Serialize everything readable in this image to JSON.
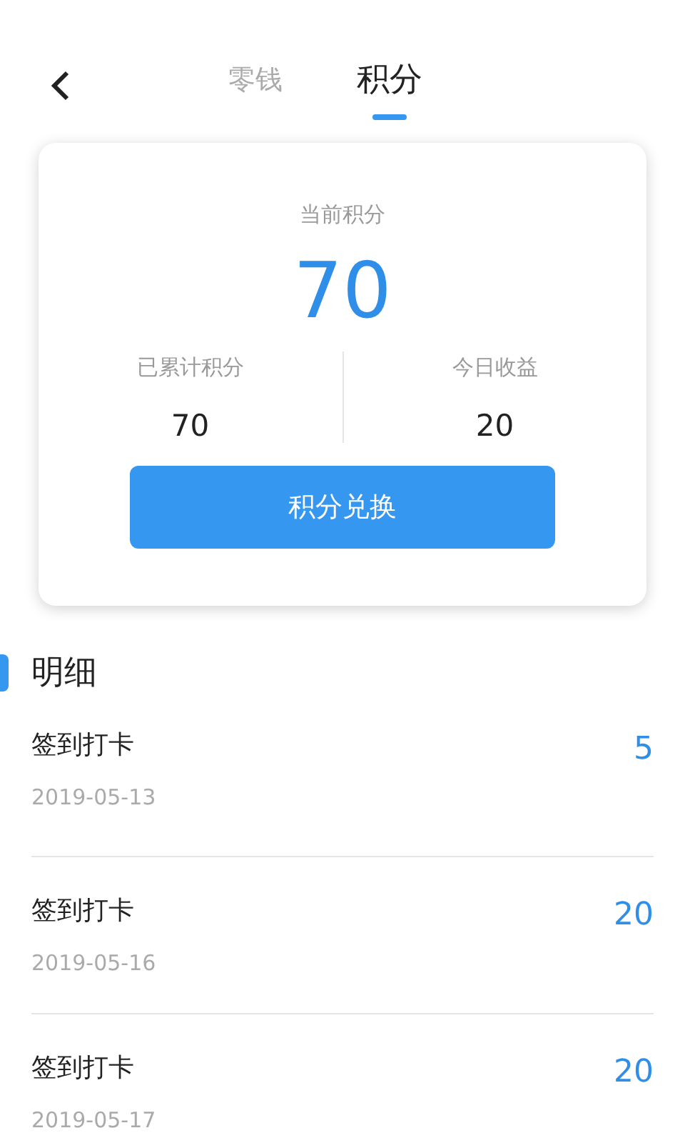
{
  "header": {
    "tabs": [
      {
        "label": "零钱",
        "selected": false
      },
      {
        "label": "积分",
        "selected": true
      }
    ]
  },
  "card": {
    "title": "当前积分",
    "points": "70",
    "stats": [
      {
        "label": "已累计积分",
        "value": "70"
      },
      {
        "label": "今日收益",
        "value": "20"
      }
    ],
    "button": "积分兑换"
  },
  "details": {
    "title": "明细",
    "items": [
      {
        "name": "签到打卡",
        "date": "2019-05-13",
        "amount": "5"
      },
      {
        "name": "签到打卡",
        "date": "2019-05-16",
        "amount": "20"
      },
      {
        "name": "签到打卡",
        "date": "2019-05-17",
        "amount": "20"
      }
    ]
  }
}
